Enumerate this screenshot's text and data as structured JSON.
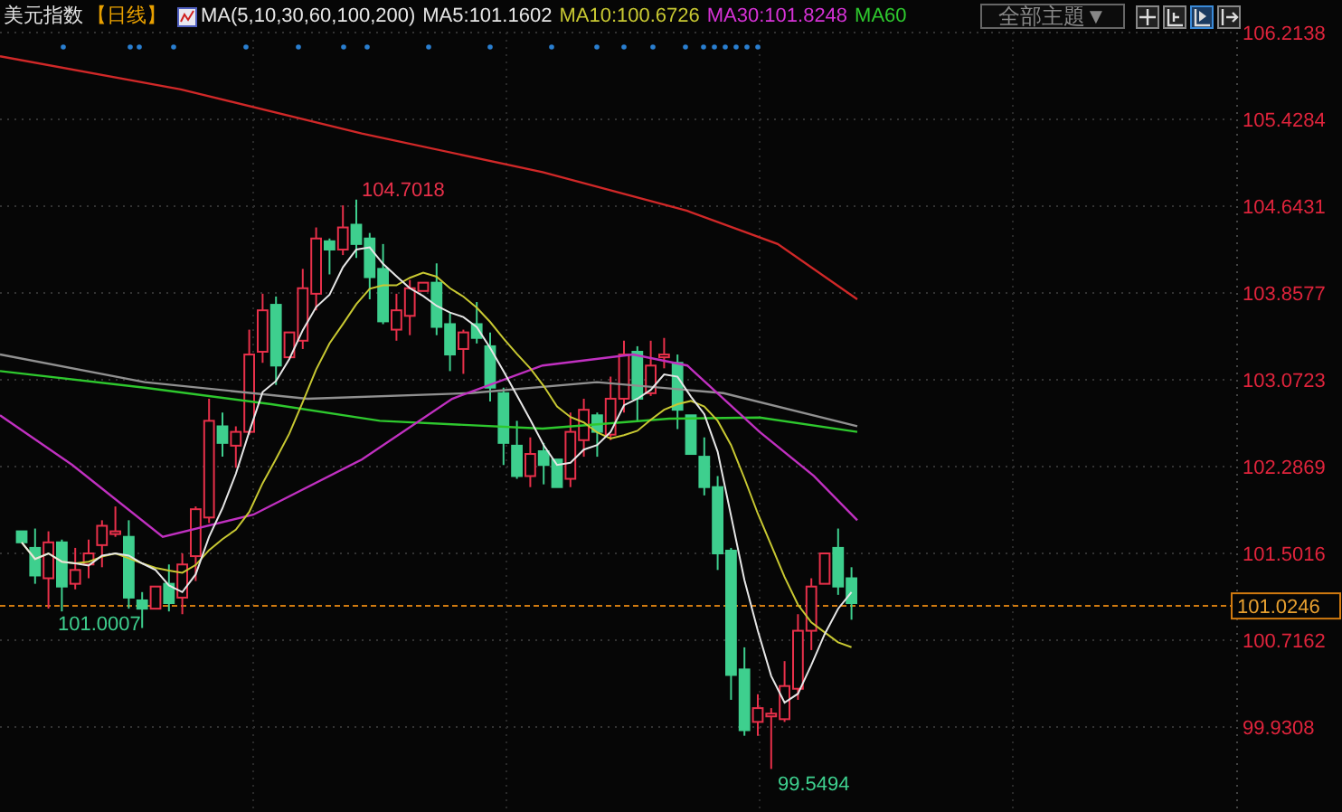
{
  "title": "美元指数",
  "period": "【日线】",
  "indicator": "MA(5,10,30,60,100,200)",
  "ma_values": [
    {
      "label": "MA5:101.1602",
      "color": "#e6e6e6"
    },
    {
      "label": "MA10:100.6726",
      "color": "#c8c832"
    },
    {
      "label": "MA30:101.8248",
      "color": "#d632d6"
    },
    {
      "label": "MA60",
      "color": "#2ec82e"
    }
  ],
  "theme_dropdown": {
    "label": "全部主題",
    "caret": "▼"
  },
  "toolbar_buttons": [
    {
      "kind": "crosshair",
      "selected": false
    },
    {
      "kind": "range",
      "selected": false
    },
    {
      "kind": "play",
      "selected": true
    },
    {
      "kind": "exit",
      "selected": false
    }
  ],
  "y_axis_labels": [
    "106.2138",
    "105.4284",
    "104.6431",
    "103.8577",
    "103.0723",
    "102.2869",
    "101.5016",
    "100.7162",
    "99.9308"
  ],
  "current_price": "101.0246",
  "high_label": "104.7018",
  "low_labels": [
    "101.0007",
    "99.5494"
  ]
}
